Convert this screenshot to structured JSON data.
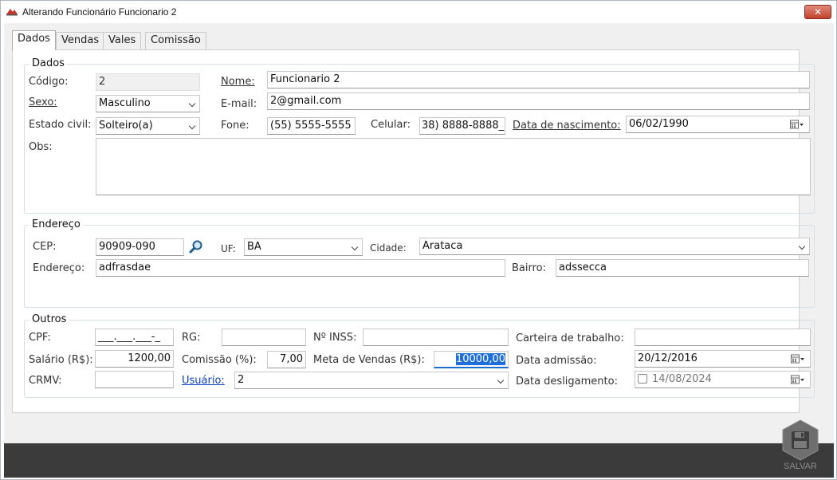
{
  "window": {
    "title": "Alterando Funcionário Funcionario 2",
    "close_symbol": "✕"
  },
  "tabs": [
    {
      "label": "Dados"
    },
    {
      "label": "Vendas"
    },
    {
      "label": "Vales"
    },
    {
      "label": "Comissão"
    }
  ],
  "dados": {
    "group_title": "Dados",
    "codigo_label": "Código:",
    "codigo_value": "2",
    "nome_label": "Nome:",
    "nome_value": "Funcionario 2",
    "sexo_label": "Sexo:",
    "sexo_value": "Masculino",
    "email_label": "E-mail:",
    "email_value": "2@gmail.com",
    "estado_civil_label": "Estado civil:",
    "estado_civil_value": "Solteiro(a)",
    "fone_label": "Fone:",
    "fone_value": "(55) 5555-5555",
    "celular_label": "Celular:",
    "celular_value": "38) 8888-8888_",
    "nascimento_label": "Data de nascimento:",
    "nascimento_value": "06/02/1990",
    "obs_label": "Obs:"
  },
  "endereco": {
    "group_title": "Endereço",
    "cep_label": "CEP:",
    "cep_value": "90909-090",
    "uf_label": "UF:",
    "uf_value": "BA",
    "cidade_label": "Cidade:",
    "cidade_value": "Arataca",
    "endereco_label": "Endereço:",
    "endereco_value": "adfrasdae",
    "bairro_label": "Bairro:",
    "bairro_value": "adssecca"
  },
  "outros": {
    "group_title": "Outros",
    "cpf_label": "CPF:",
    "cpf_value": "___.___.___-_",
    "rg_label": "RG:",
    "rg_value": "",
    "inss_label": "Nº INSS:",
    "inss_value": "",
    "carteira_label": "Carteira de trabalho:",
    "carteira_value": "",
    "salario_label": "Salário (R$):",
    "salario_value": "1200,00",
    "comissao_label": "Comissão (%):",
    "comissao_value": "7,00",
    "meta_label": "Meta de Vendas (R$):",
    "meta_value": "10000,00",
    "admissao_label": "Data admissão:",
    "admissao_value": "20/12/2016",
    "crmv_label": "CRMV:",
    "crmv_value": "",
    "usuario_label": "Usuário:",
    "usuario_value": "2",
    "desligamento_label": "Data desligamento:",
    "desligamento_value": "14/08/2024"
  },
  "footer": {
    "save_label": "SALVAR"
  },
  "colors": {
    "footer_bg": "#3b3b3b",
    "link": "#0a3fc2",
    "selection": "#1e6fd9",
    "close_button": "#c2412c"
  }
}
